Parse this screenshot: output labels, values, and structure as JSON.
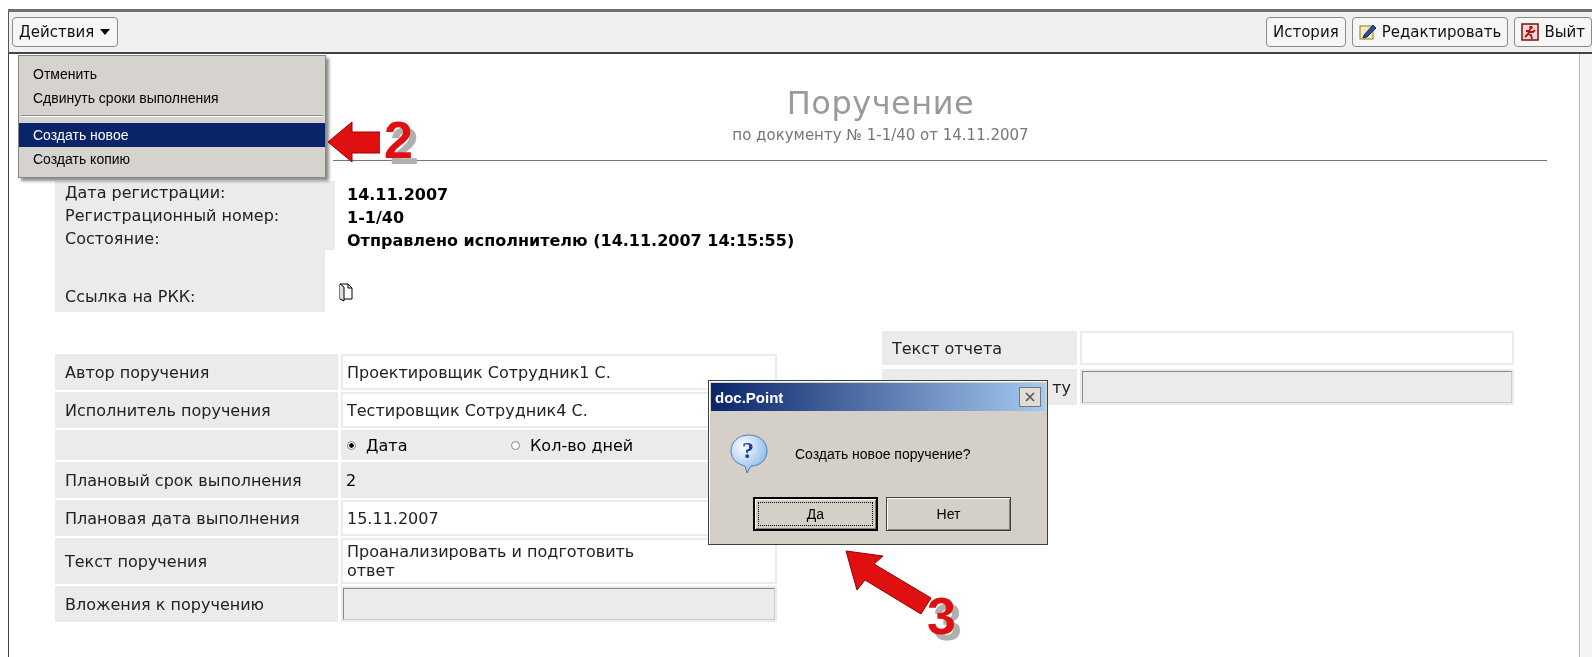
{
  "toolbar": {
    "actions_button": {
      "label": "Действия"
    },
    "buttons": [
      {
        "label": "История"
      },
      {
        "label": "Редактировать"
      },
      {
        "label": "Выйт"
      }
    ]
  },
  "actions_menu": {
    "items": [
      {
        "kind": "item",
        "label": "Отменить",
        "selected": false
      },
      {
        "kind": "item",
        "label": "Сдвинуть сроки выполнения",
        "selected": false
      },
      {
        "kind": "separator"
      },
      {
        "kind": "item",
        "label": "Создать новое",
        "selected": true
      },
      {
        "kind": "item",
        "label": "Создать копию",
        "selected": false
      }
    ]
  },
  "header": {
    "title": "Поручение",
    "subtitle": "по документу № 1-1/40 от 14.11.2007"
  },
  "info": [
    {
      "kind": "text",
      "label": "Дата регистрации:",
      "value": "14.11.2007"
    },
    {
      "kind": "text",
      "label": "Регистрационный номер:",
      "value": "1-1/40"
    },
    {
      "kind": "text",
      "label": "Состояние:",
      "value": "Отправлено исполнителю (14.11.2007 14:15:55)"
    },
    {
      "kind": "link",
      "label": "Ссылка на РКК:"
    }
  ],
  "form": {
    "rows": [
      {
        "kind": "text",
        "label": "Автор поручения",
        "value": "Проектировщик Сотрудник1 С."
      },
      {
        "kind": "text",
        "label": "Исполнитель поручения",
        "value": "Тестировщик Сотрудник4 С."
      },
      {
        "kind": "radio",
        "options": [
          {
            "label": "Дата",
            "selected": true
          },
          {
            "label": "Кол-во дней",
            "selected": false
          }
        ]
      },
      {
        "kind": "plain",
        "label": "Плановый срок выполнения",
        "value": "2"
      },
      {
        "kind": "text",
        "label": "Плановая дата выполнения",
        "value": "15.11.2007"
      },
      {
        "kind": "text",
        "label": "Текст поручения",
        "value": "Проанализировать и подготовить ответ"
      },
      {
        "kind": "file",
        "label": "Вложения к поручению"
      }
    ]
  },
  "report": {
    "rows": [
      {
        "kind": "text",
        "label": "Текст отчета"
      },
      {
        "kind": "file",
        "label": "ту"
      }
    ]
  },
  "dialog": {
    "title": "doc.Point",
    "icon_glyph": "?",
    "message": "Создать новое поручение?",
    "buttons": [
      {
        "label": "Да",
        "focused": true
      },
      {
        "label": "Нет",
        "focused": false
      }
    ]
  },
  "annotations": [
    {
      "label": "2"
    },
    {
      "label": "3"
    }
  ]
}
